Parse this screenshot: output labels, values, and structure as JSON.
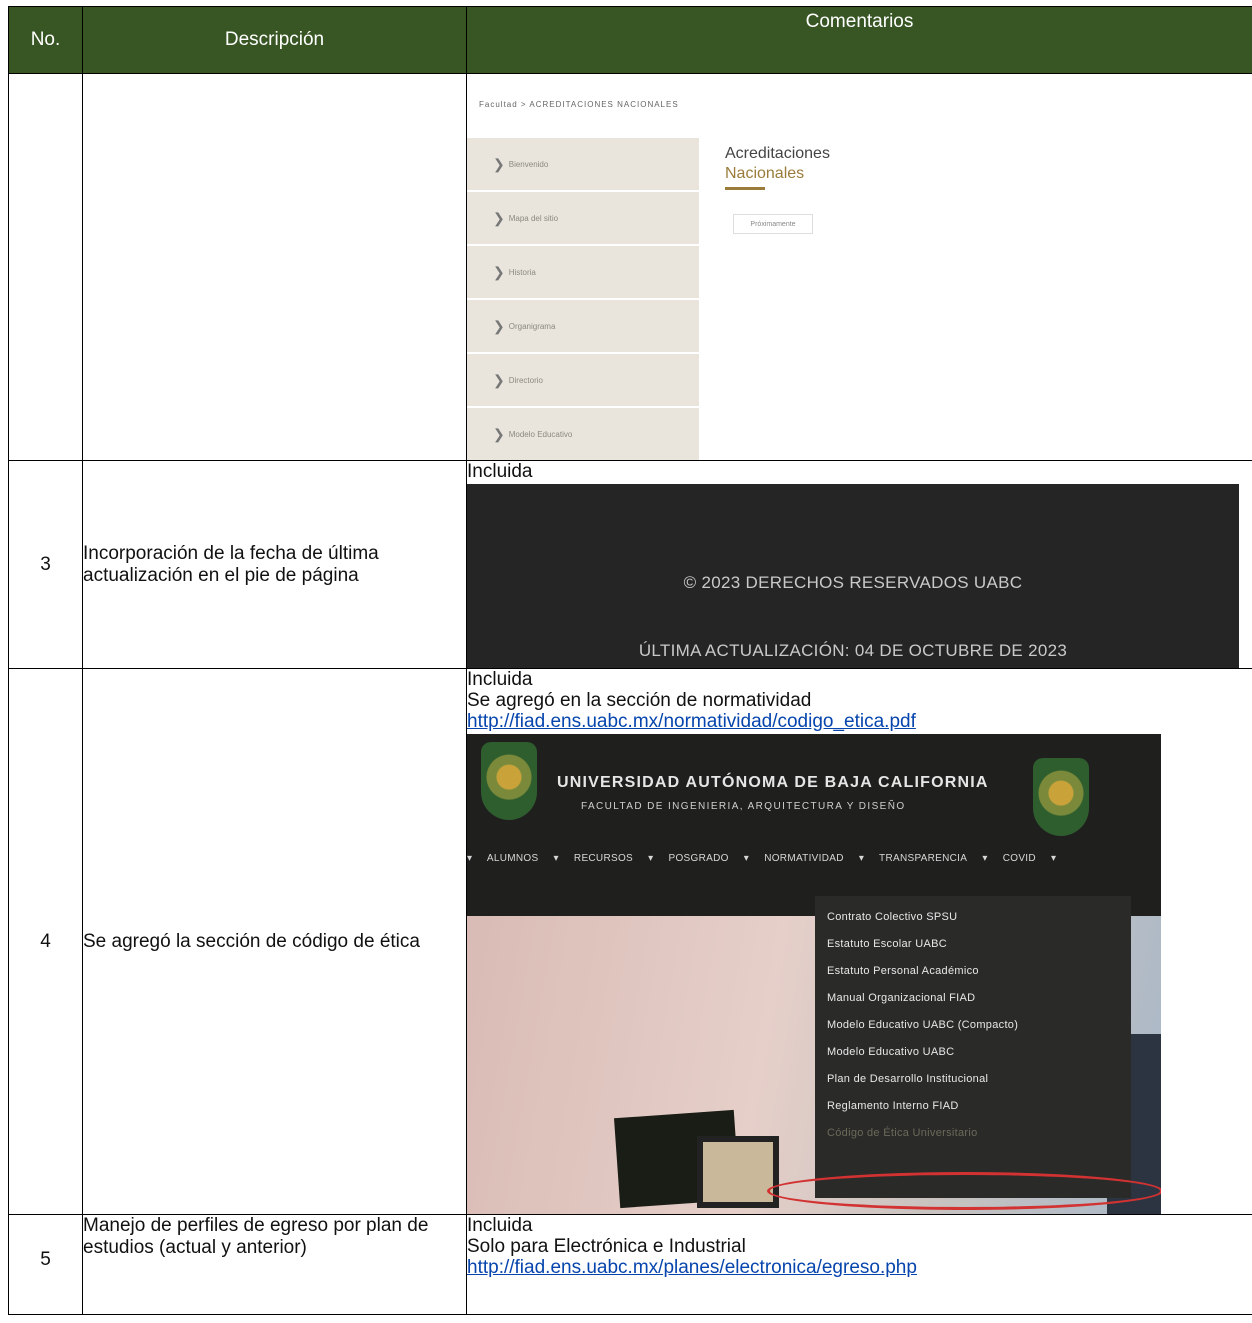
{
  "table": {
    "headers": {
      "no": "No.",
      "description": "Descripción",
      "comments": "Comentarios"
    }
  },
  "row1": {
    "screenshot": {
      "breadcrumb": "Facultad  >  ACREDITACIONES NACIONALES",
      "menu": [
        "Bienvenido",
        "Mapa del sitio",
        "Historia",
        "Organigrama",
        "Directorio",
        "Modelo Educativo"
      ],
      "title": "Acreditaciones",
      "subtitle": "Nacionales",
      "chip": "Próximamente"
    }
  },
  "row2": {
    "no": "3",
    "description": "Incorporación de la fecha de última actualización en el pie de página",
    "status": "Incluida",
    "footer_copyright": "© 2023 DERECHOS RESERVADOS UABC",
    "footer_updated": "ÚLTIMA ACTUALIZACIÓN: 04 DE OCTUBRE DE 2023"
  },
  "row3": {
    "no": "4",
    "description": "Se agregó la sección de código de ética",
    "status": "Incluida",
    "note": "Se agregó en la sección de normatividad",
    "link": "http://fiad.ens.uabc.mx/normatividad/codigo_etica.pdf",
    "screenshot": {
      "university": "UNIVERSIDAD AUTÓNOMA DE BAJA CALIFORNIA",
      "faculty": "FACULTAD DE INGENIERIA, ARQUITECTURA Y DISEÑO",
      "nav": [
        "ALUMNOS",
        "RECURSOS",
        "POSGRADO",
        "NORMATIVIDAD",
        "TRANSPARENCIA",
        "COVID"
      ],
      "dropdown": [
        "Contrato Colectivo SPSU",
        "Estatuto Escolar UABC",
        "Estatuto Personal Académico",
        "Manual Organizacional FIAD",
        "Modelo Educativo UABC (Compacto)",
        "Modelo Educativo UABC",
        "Plan de Desarrollo Institucional",
        "Reglamento Interno FIAD",
        "Código de Ética Universitario"
      ]
    }
  },
  "row4": {
    "no": "5",
    "description": "Manejo de perfiles de egreso por plan de estudios (actual y anterior)",
    "status": "Incluida",
    "note": "Solo para Electrónica e Industrial",
    "link": "http://fiad.ens.uabc.mx/planes/electronica/egreso.php"
  },
  "colors": {
    "header_bg": "#375623",
    "link": "#0645ad",
    "highlight_ring": "#d23232"
  }
}
